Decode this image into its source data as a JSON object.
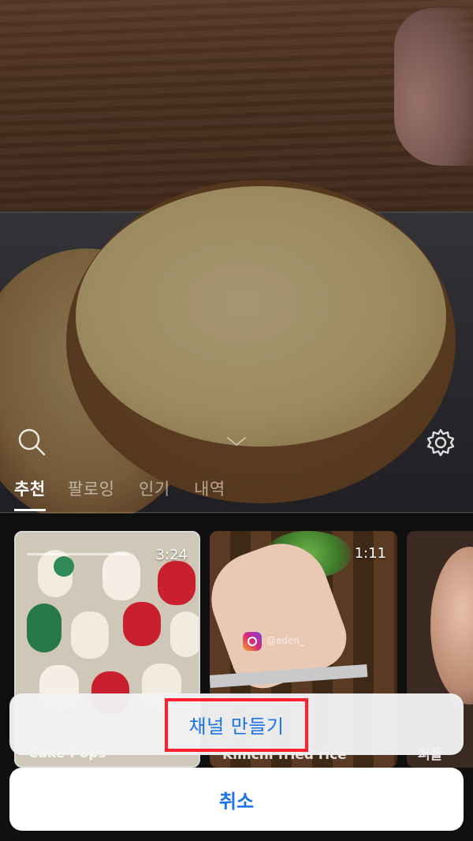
{
  "top_bar": {
    "search_icon": "search-icon",
    "settings_icon": "gear-icon",
    "collapse_icon": "chevron-down-icon"
  },
  "tabs": [
    {
      "label": "추천",
      "active": true
    },
    {
      "label": "팔로잉",
      "active": false
    },
    {
      "label": "인기",
      "active": false
    },
    {
      "label": "내역",
      "active": false
    }
  ],
  "cards": [
    {
      "duration": "3:24",
      "title": "Cake Pops"
    },
    {
      "duration": "1:11",
      "title": "Kimchi fried rice",
      "handle": "@eden_"
    },
    {
      "title": "퍼플"
    }
  ],
  "action_sheet": {
    "option_label": "채널 만들기",
    "cancel_label": "취소",
    "accent_color": "#1a73e8",
    "highlight_color": "#ff1f2d"
  }
}
